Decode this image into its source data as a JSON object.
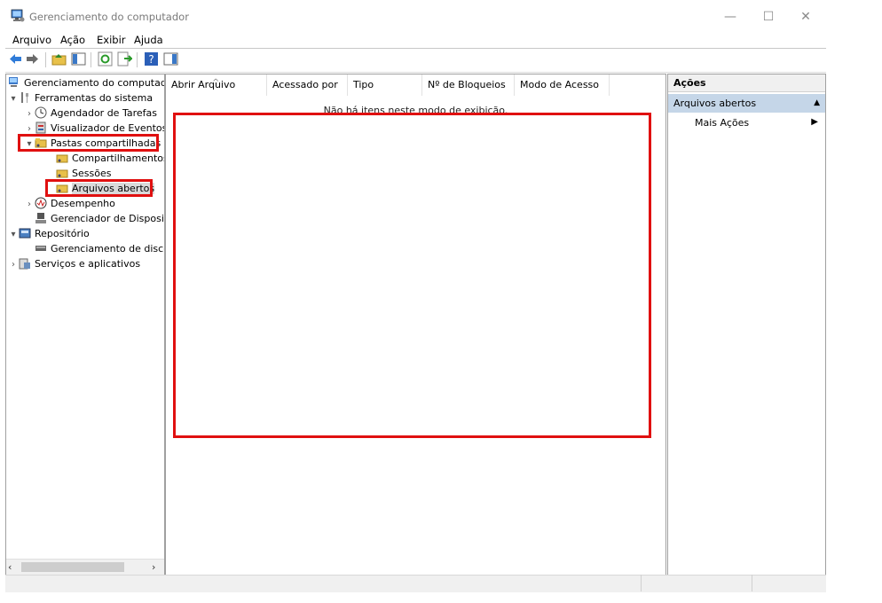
{
  "window": {
    "title": "Gerenciamento do computador",
    "controls": {
      "minimize": "—",
      "maximize": "☐",
      "close": "✕"
    }
  },
  "menu": {
    "items": [
      "Arquivo",
      "Ação",
      "Exibir",
      "Ajuda"
    ]
  },
  "toolbar": {
    "buttons": [
      "back-arrow-icon",
      "forward-arrow-icon",
      "up-folder-icon",
      "show-hide-tree-icon",
      "refresh-icon",
      "export-list-icon",
      "help-icon",
      "show-hide-action-pane-icon"
    ]
  },
  "tree": {
    "root": "Gerenciamento do computado",
    "items": [
      {
        "label": "Ferramentas do sistema",
        "expander": "▾"
      },
      {
        "label": "Agendador de Tarefas",
        "expander": "›"
      },
      {
        "label": "Visualizador de Eventos",
        "expander": "›"
      },
      {
        "label": "Pastas compartilhadas",
        "expander": "▾"
      },
      {
        "label": "Compartilhamentos",
        "expander": ""
      },
      {
        "label": "Sessões",
        "expander": ""
      },
      {
        "label": "Arquivos abertos",
        "expander": ""
      },
      {
        "label": "Desempenho",
        "expander": "›"
      },
      {
        "label": "Gerenciador de Disposit",
        "expander": ""
      },
      {
        "label": "Repositório",
        "expander": "▾"
      },
      {
        "label": "Gerenciamento de disco",
        "expander": ""
      },
      {
        "label": "Serviços e aplicativos",
        "expander": "›"
      }
    ],
    "scroll_left": "‹",
    "scroll_right": "›"
  },
  "list": {
    "columns": [
      "Abrir Arquivo",
      "Acessado por",
      "Tipo",
      "Nº de Bloqueios",
      "Modo de Acesso"
    ],
    "sort_indicator": "^",
    "empty_message": "Não há itens neste modo de exibição."
  },
  "actions": {
    "title": "Ações",
    "section": "Arquivos abertos",
    "section_arrow": "▲",
    "more": "Mais Ações",
    "more_arrow": "▶"
  },
  "colors": {
    "highlight": "#e01010",
    "section_bg": "#c5d6e8"
  }
}
